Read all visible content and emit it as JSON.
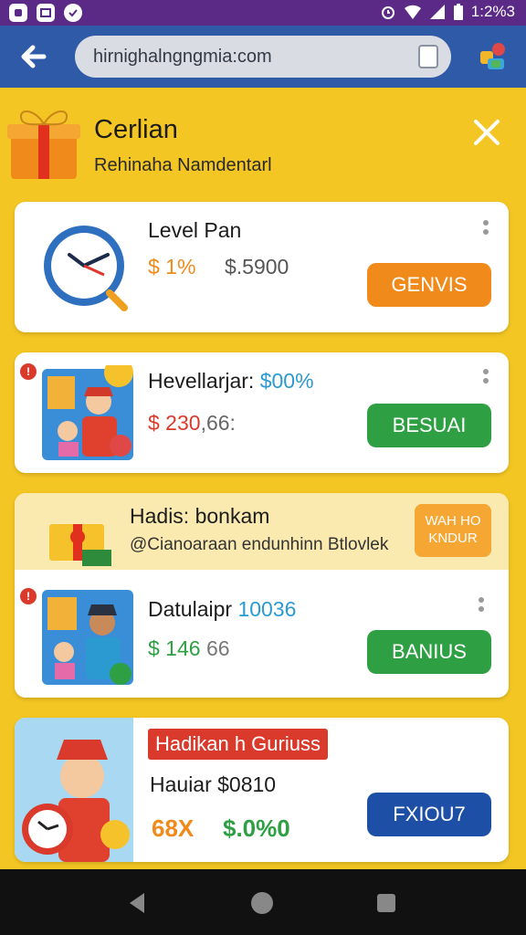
{
  "status_bar": {
    "time": "1:2%3",
    "icons": [
      "square-icon",
      "mail-icon",
      "check-icon",
      "alarm-icon",
      "wifi-icon",
      "signal-icon",
      "battery-icon"
    ]
  },
  "browser": {
    "url": "hirnighalngngmia:com"
  },
  "header": {
    "title": "Cerlian",
    "subtitle": "Rehinaha Namdentarl"
  },
  "cards": [
    {
      "title": "Level Pan",
      "pct": "$ 1%",
      "price": "$.5900",
      "button": "GENVIS"
    },
    {
      "title": "Hevellarjar:",
      "title_pct": "$00%",
      "price": "$ 230",
      "price_suffix": ",66:",
      "button": "BESUAI"
    },
    {
      "title": "Datulaipr",
      "title_pct": "10036",
      "price": "$ 146",
      "price_suffix": "66",
      "button": "BANIUS"
    },
    {
      "tag": "Hadikan h Guriuss",
      "title": "Hauiar $0810",
      "pct": "68X",
      "price": "$.0%0",
      "button": "FXIOU7"
    }
  ],
  "promo": {
    "title": "Hadis: bonkam",
    "subtitle": "@Cianoaraan endunhinn Btlovlek",
    "button_line1": "WAH HO",
    "button_line2": "KNDUR"
  },
  "colors": {
    "orange": "#f08a1a",
    "green": "#2ea043",
    "blue": "#1e4fa6",
    "red": "#d93a2b",
    "teal": "#2b9ad1",
    "status_purple": "#5b2a86",
    "browser_blue": "#2f5aa8",
    "background_yellow": "#f3c623"
  }
}
